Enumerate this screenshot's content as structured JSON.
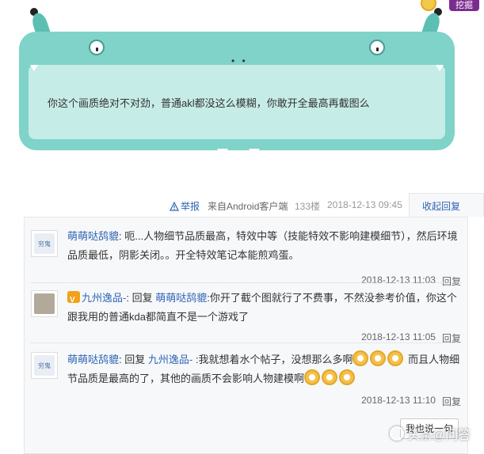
{
  "top_badge": {
    "label": "挖掘"
  },
  "post": {
    "text": "你这个画质绝对不对劲，普通akl都没这么模糊，你敢开全最高再截图么",
    "monster_nose": "• •"
  },
  "meta": {
    "report": "举报",
    "source": "来自Android客户端",
    "floor": "133楼",
    "time": "2018-12-13 09:45",
    "collapse": "收起回复"
  },
  "replies": [
    {
      "avatar": "穷鬼",
      "user": "萌萌哒鸹貔",
      "separator": ": ",
      "text": "呃...人物细节品质最高，特效中等（技能特效不影响建模细节），然后环境品质最低，阴影关闭。。开全特效笔记本能煎鸡蛋。",
      "time": "2018-12-13 11:03",
      "reply_label": "回复"
    },
    {
      "avatar": "",
      "user": "九州逸品-",
      "separator": ": ",
      "reply_word": "回复 ",
      "target": "萌萌哒鸹貔",
      "text": ":你开了截个图就行了不费事，不然没参考价值，你这个跟我用的普通kda都简直不是一个游戏了",
      "time": "2018-12-13 11:05",
      "reply_label": "回复"
    },
    {
      "avatar": "穷鬼",
      "user": "萌萌哒鸹貔",
      "separator": ": ",
      "reply_word": "回复 ",
      "target": "九州逸品-",
      "text_a": " :我就想着水个帖子，没想那么多啊",
      "text_b": " 而且人物细节品质是最高的了，其他的画质不会影响人物建模啊",
      "time": "2018-12-13 11:10",
      "reply_label": "回复"
    }
  ],
  "say_button": "我也说一句",
  "watermark": "头条@问答",
  "colors": {
    "accent": "#2d64b3",
    "monster": "#7fd3c9",
    "monster_inner": "#c6ece7"
  }
}
